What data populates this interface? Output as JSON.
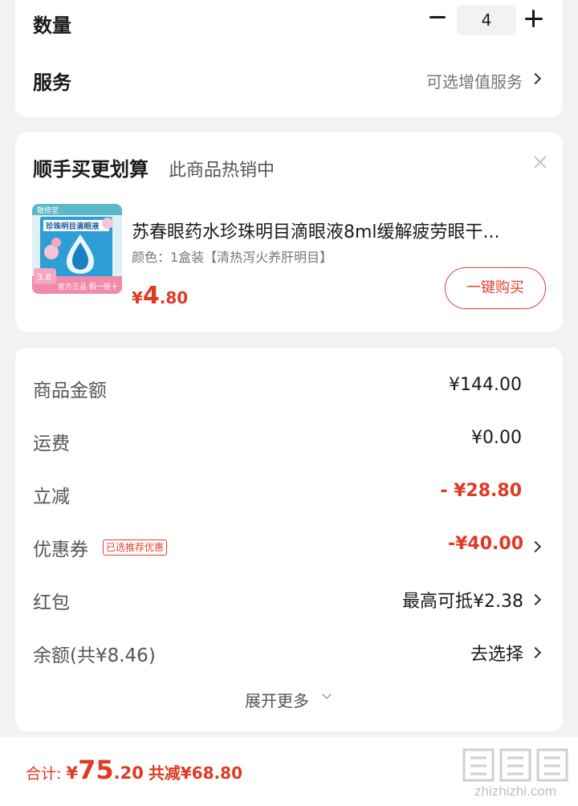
{
  "quantity": {
    "label": "数量",
    "value": "4"
  },
  "service": {
    "label": "服务",
    "value": "可选增值服务"
  },
  "bundle": {
    "title": "顺手买更划算",
    "subtitle": "此商品热销中",
    "product": {
      "name": "苏春眼药水珍珠明目滴眼液8ml缓解疲劳眼干...",
      "spec": "颜色：1盒装【清热泻火养肝明目】",
      "price_currency": "¥",
      "price_int": "4",
      "price_dec": ".80",
      "image": {
        "brand": "敬修堂",
        "box_title": "珍珠明目滴眼液",
        "badge_price": "3.8",
        "banner": "官方正品 假一赔十"
      }
    },
    "buy_button": "一键购买"
  },
  "fees": {
    "goods_amount": {
      "label": "商品金额",
      "value": "¥144.00"
    },
    "shipping": {
      "label": "运费",
      "value": "¥0.00"
    },
    "instant_discount": {
      "label": "立减",
      "value": "- ¥28.80"
    },
    "coupon": {
      "label": "优惠券",
      "tag": "已选推荐优惠",
      "value": "-¥40.00"
    },
    "red_packet": {
      "label": "红包",
      "value": "最高可抵¥2.38"
    },
    "balance": {
      "label": "余额(共¥8.46)",
      "value": "去选择"
    },
    "expand": "展开更多"
  },
  "bottom": {
    "total_label": "合计: ",
    "currency": "¥",
    "total_int": "75",
    "total_dec": ".20",
    "discount": "共减¥68.80"
  },
  "watermark": {
    "text": "zhizhizhi.com",
    "logo_text": "值值值"
  },
  "colors": {
    "accent": "#e03a24",
    "background": "#f2f2f2",
    "card": "#ffffff"
  }
}
